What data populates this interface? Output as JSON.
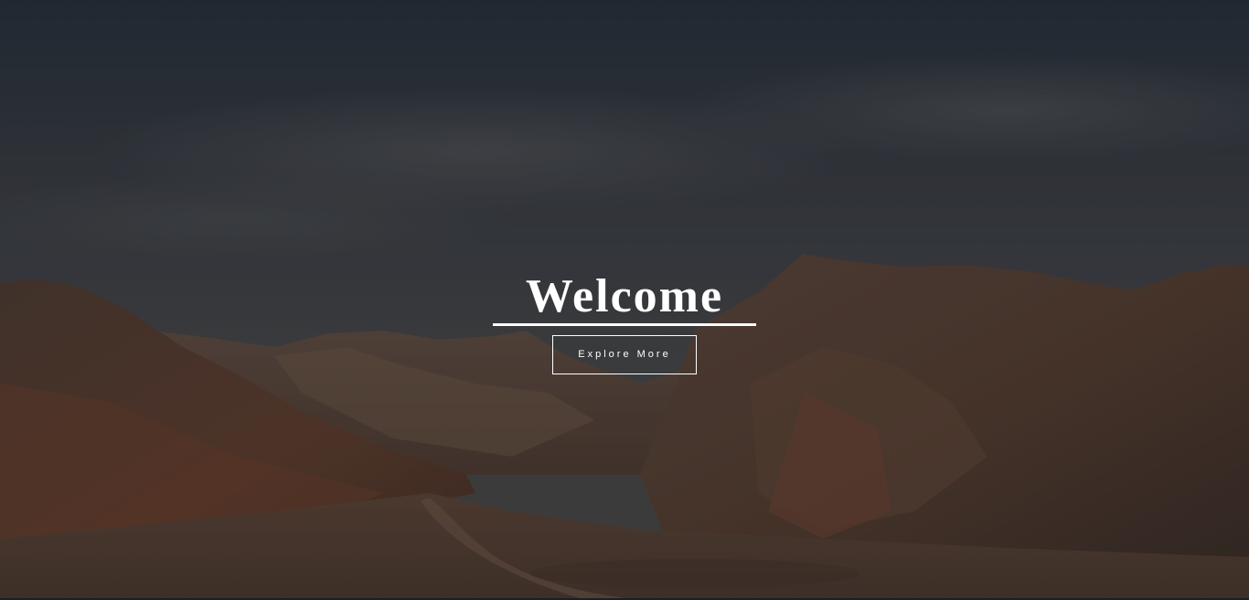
{
  "hero": {
    "title": "Welcome",
    "button_label": "Explore More",
    "background": "desert-mountain-landscape-image"
  },
  "colors": {
    "sky_top": "#2b343f",
    "sky_bottom": "#4a4a4d",
    "mountain_dark": "#4f3f37",
    "mountain_warm": "#6a4a3a",
    "ground": "#5a4438",
    "text": "#ffffff"
  }
}
